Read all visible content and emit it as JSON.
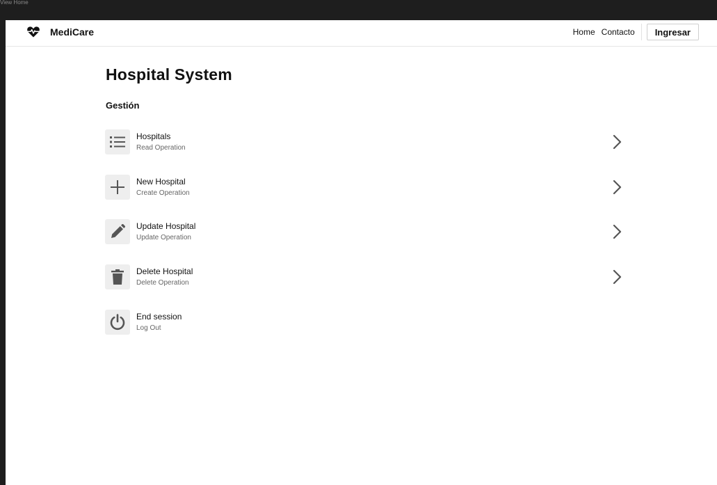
{
  "window": {
    "title": "View Home"
  },
  "navbar": {
    "brand": "MediCare",
    "links": {
      "home": "Home",
      "contact": "Contacto"
    },
    "login_label": "Ingresar"
  },
  "page": {
    "title": "Hospital System",
    "section": "Gestión"
  },
  "menu": {
    "items": [
      {
        "title": "Hospitals",
        "subtitle": "Read Operation",
        "icon": "list-icon",
        "has_chevron": true
      },
      {
        "title": "New Hospital",
        "subtitle": "Create Operation",
        "icon": "plus-icon",
        "has_chevron": true
      },
      {
        "title": "Update Hospital",
        "subtitle": "Update Operation",
        "icon": "pencil-icon",
        "has_chevron": true
      },
      {
        "title": "Delete Hospital",
        "subtitle": "Delete Operation",
        "icon": "trash-icon",
        "has_chevron": true
      },
      {
        "title": "End session",
        "subtitle": "Log Out",
        "icon": "power-icon",
        "has_chevron": false
      }
    ]
  },
  "colors": {
    "icon_gray": "#555555",
    "icon_box": "#eeeeee",
    "chevron": "#555555",
    "frame": "#1e1e1e"
  }
}
